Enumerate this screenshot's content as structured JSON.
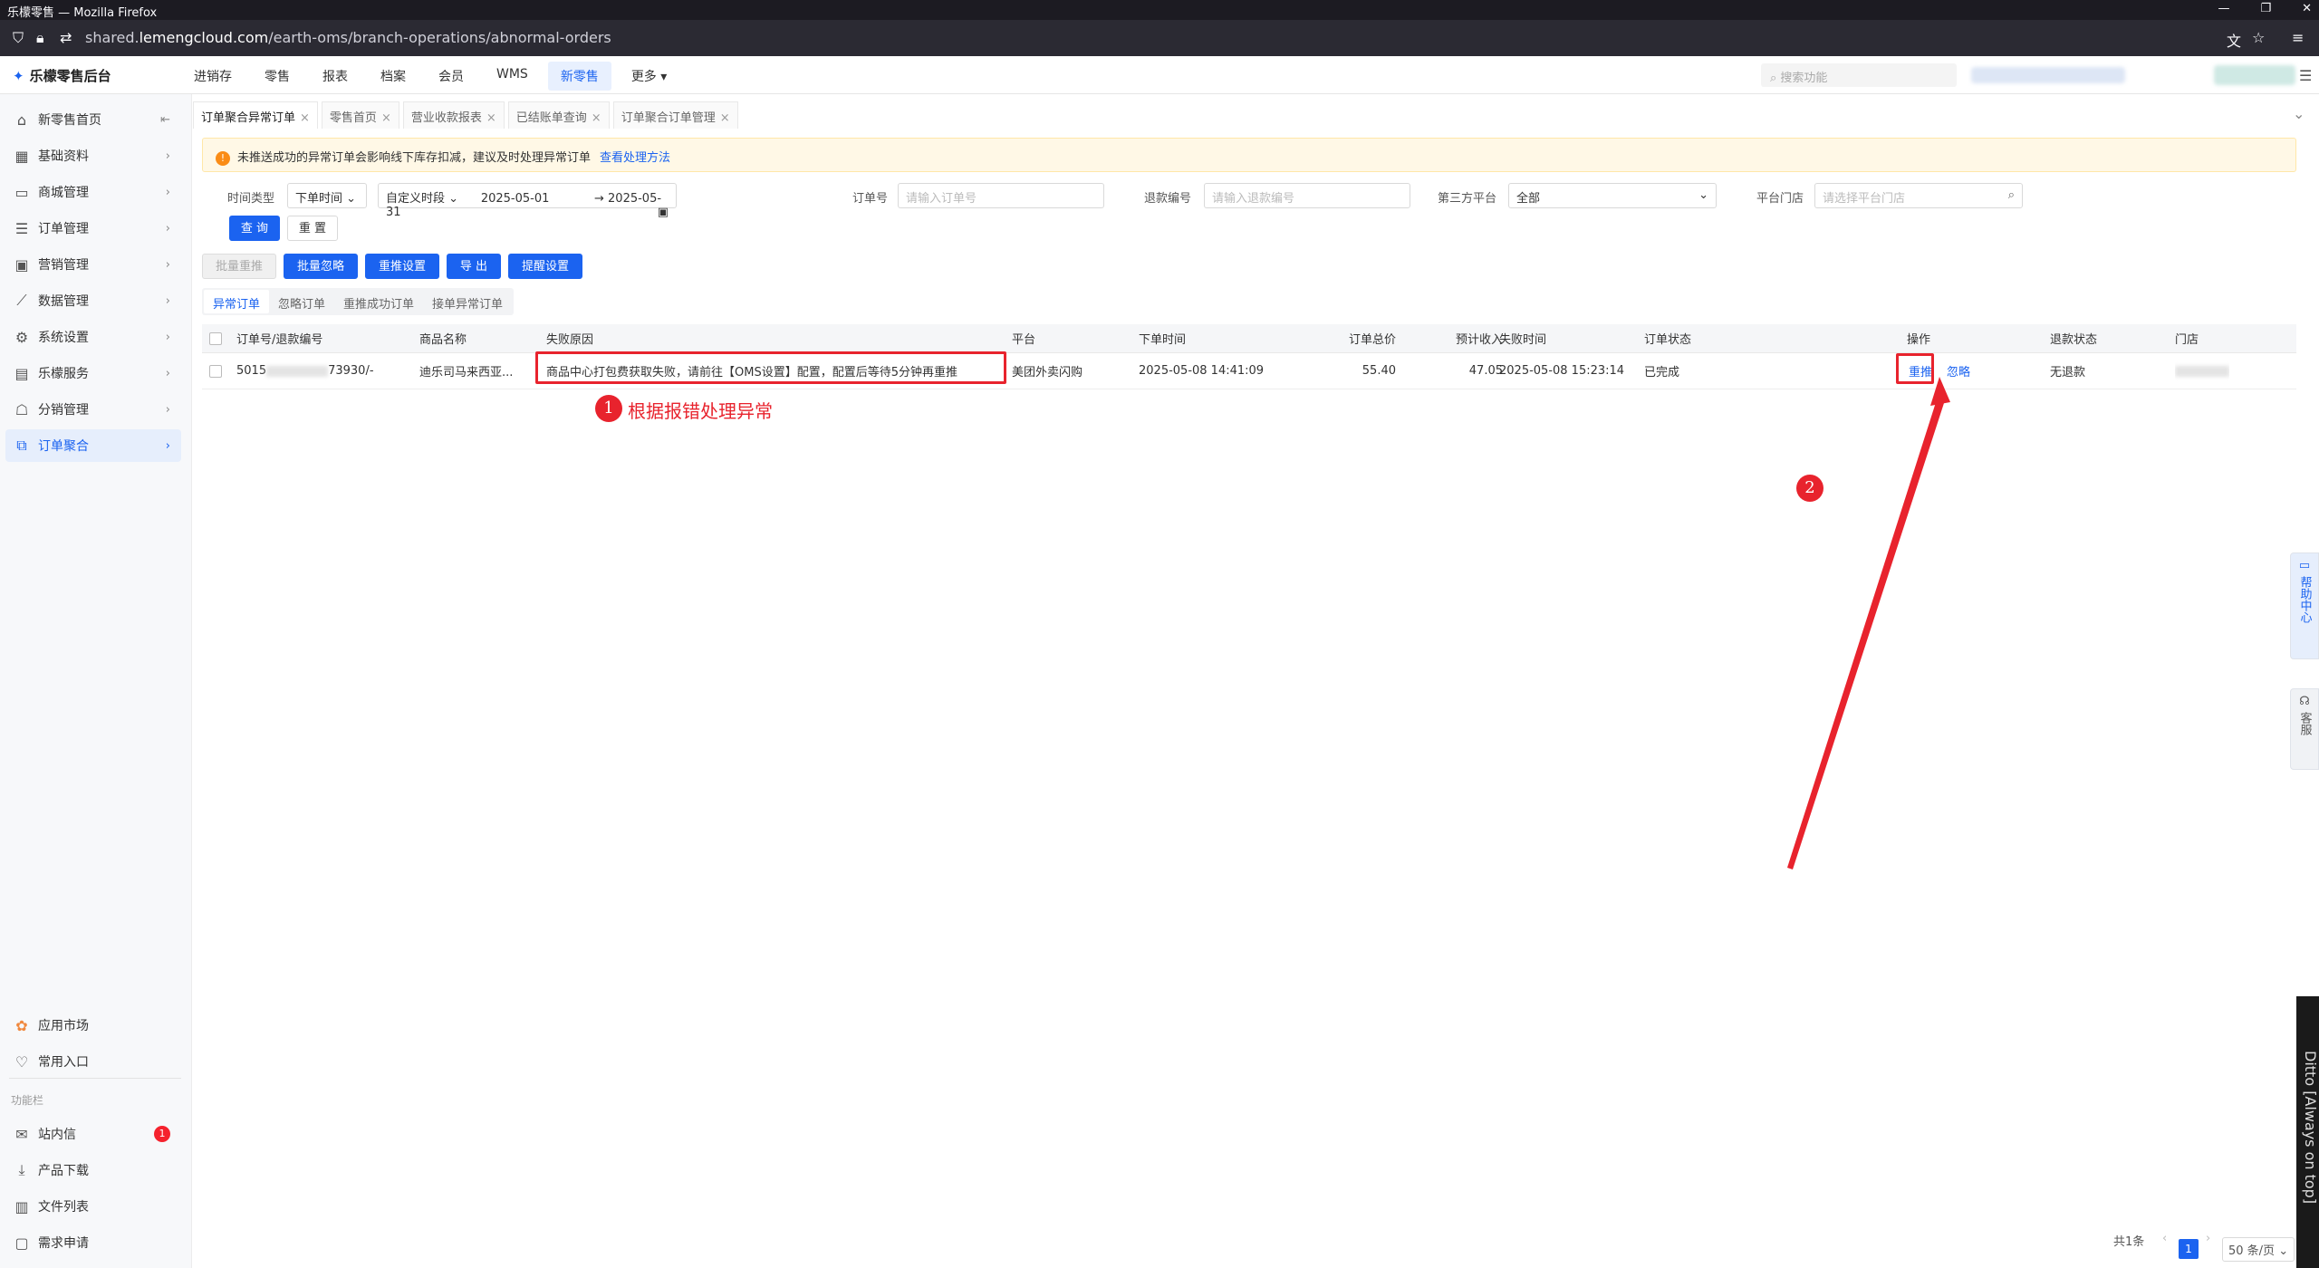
{
  "browser": {
    "title": "乐檬零售 — Mozilla Firefox",
    "url_prefix": "shared.",
    "url_domain": "lemengcloud.com",
    "url_path": "/earth-oms/branch-operations/abnormal-orders"
  },
  "app": {
    "logo": "乐檬零售后台",
    "search_placeholder": "搜索功能"
  },
  "topnav": [
    "进销存",
    "零售",
    "报表",
    "档案",
    "会员",
    "WMS",
    "新零售",
    "更多"
  ],
  "sidebar": {
    "items": [
      "新零售首页",
      "基础资料",
      "商城管理",
      "订单管理",
      "营销管理",
      "数据管理",
      "系统设置",
      "乐檬服务",
      "分销管理",
      "订单聚合"
    ],
    "bottom": [
      "应用市场",
      "常用入口"
    ],
    "section_label": "功能栏",
    "func": [
      "站内信",
      "产品下载",
      "文件列表",
      "需求申请"
    ],
    "badge": "1"
  },
  "tabs": [
    "订单聚合异常订单",
    "零售首页",
    "营业收款报表",
    "已结账单查询",
    "订单聚合订单管理"
  ],
  "alert": {
    "text": "未推送成功的异常订单会影响线下库存扣减，建议及时处理异常订单",
    "link": "查看处理方法"
  },
  "filters": {
    "time_type_label": "时间类型",
    "time_type": "下单时间",
    "range_type": "自定义时段",
    "date_from": "2025-05-01",
    "date_to": "2025-05-31",
    "order_no_label": "订单号",
    "order_no_ph": "请输入订单号",
    "refund_label": "退款编号",
    "refund_ph": "请输入退款编号",
    "third_label": "第三方平台",
    "third_value": "全部",
    "store_label": "平台门店",
    "store_ph": "请选择平台门店",
    "query": "查 询",
    "reset": "重 置"
  },
  "actions": [
    "批量重推",
    "批量忽略",
    "重推设置",
    "导 出",
    "提醒设置"
  ],
  "subtabs": [
    "异常订单",
    "忽略订单",
    "重推成功订单",
    "接单异常订单"
  ],
  "columns": [
    "订单号/退款编号",
    "商品名称",
    "失败原因",
    "平台",
    "下单时间",
    "订单总价",
    "预计收入",
    "失败时间",
    "订单状态",
    "操作",
    "退款状态",
    "门店"
  ],
  "row": {
    "order_a": "5015",
    "order_b": "73930/-",
    "product": "迪乐司马来西亚...",
    "reason": "商品中心打包费获取失败，请前往【OMS设置】配置，配置后等待5分钟再重推",
    "platform": "美团外卖闪购",
    "order_time": "2025-05-08 14:41:09",
    "total": "55.40",
    "income": "47.05",
    "fail_time": "2025-05-08 15:23:14",
    "status": "已完成",
    "op_retry": "重推",
    "op_ignore": "忽略",
    "refund_status": "无退款"
  },
  "annotations": {
    "n1": "1",
    "text1": "根据报错处理异常",
    "n2": "2"
  },
  "pager": {
    "total": "共1条",
    "page": "1",
    "size": "50 条/页"
  },
  "float": {
    "help": "帮助中心",
    "service": "客服"
  },
  "ditto": "Ditto [Always on top]"
}
